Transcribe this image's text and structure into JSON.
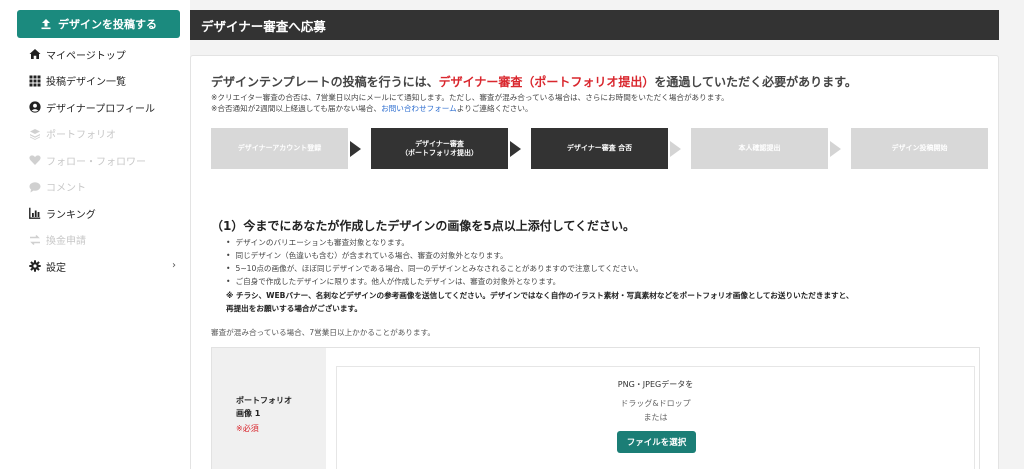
{
  "sidebar": {
    "post_button": "デザインを投稿する",
    "items": [
      {
        "label": "マイページトップ",
        "icon": "home-icon",
        "enabled": true
      },
      {
        "label": "投稿デザイン一覧",
        "icon": "grid-icon",
        "enabled": true
      },
      {
        "label": "デザイナープロフィール",
        "icon": "user-icon",
        "enabled": true
      },
      {
        "label": "ポートフォリオ",
        "icon": "layers-icon",
        "enabled": false
      },
      {
        "label": "フォロー・フォロワー",
        "icon": "heart-icon",
        "enabled": false
      },
      {
        "label": "コメント",
        "icon": "comment-icon",
        "enabled": false
      },
      {
        "label": "ランキング",
        "icon": "chart-icon",
        "enabled": true
      },
      {
        "label": "換金申請",
        "icon": "exchange-icon",
        "enabled": false
      },
      {
        "label": "設定",
        "icon": "gear-icon",
        "enabled": true,
        "chevron": "›"
      }
    ]
  },
  "header": {
    "title": "デザイナー審査へ応募"
  },
  "main": {
    "lead_before": "デザインテンプレートの投稿を行うには、",
    "lead_emph": "デザイナー審査（ポートフォリオ提出）",
    "lead_after": "を通過していただく必要があります。",
    "note1": "※クリエイター審査の合否は、7営業日以内にメールにて通知します。ただし、審査が混み合っている場合は、さらにお時間をいただく場合があります。",
    "note2_before": "※合否通知が2週間以上経過しても届かない場合、",
    "note2_link": "お問い合わせフォーム",
    "note2_after": "よりご連絡ください。",
    "steps": [
      {
        "label": "デザイナーアカウント登録",
        "state": "done"
      },
      {
        "label": "デザイナー審査\n（ポートフォリオ提出）",
        "state": "current"
      },
      {
        "label": "デザイナー審査 合否",
        "state": "current"
      },
      {
        "label": "本人確認提出",
        "state": "pending"
      },
      {
        "label": "デザイン投稿開始",
        "state": "pending"
      }
    ],
    "section_title": "（1）今までにあなたが作成したデザインの画像を5点以上添付してください。",
    "bullets": [
      "デザインのバリエーションも審査対象となります。",
      "同じデザイン（色違いも含む）が含まれている場合、審査の対象外となります。",
      "5~10点の画像が、ほぼ同じデザインである場合、同一のデザインとみなされることがありますので注意してください。",
      "ご自身で作成したデザインに限ります。他人が作成したデザインは、審査の対象外となります。"
    ],
    "warning_line1": "※ チラシ、WEBバナー、名刺などデザインの参考画像を送信してください。デザインではなく自作のイラスト素材・写真素材などをポートフォリオ画像としてお送りいただきますと、",
    "warning_line2": "再提出をお願いする場合がございます。",
    "review_note": "審査が混み合っている場合、7営業日以上かかることがあります。",
    "upload": {
      "label_line1": "ポートフォリオ",
      "label_line2": "画像 1",
      "required": "※必須",
      "drop_line1": "PNG・JPEGデータを",
      "drop_line2": "ドラッグ&ドロップ",
      "drop_line3": "または",
      "button": "ファイルを選択"
    }
  },
  "colors": {
    "accent": "#1b8a7e",
    "header": "#333333",
    "emphasis": "#d9272e",
    "link": "#2f6fd0"
  }
}
